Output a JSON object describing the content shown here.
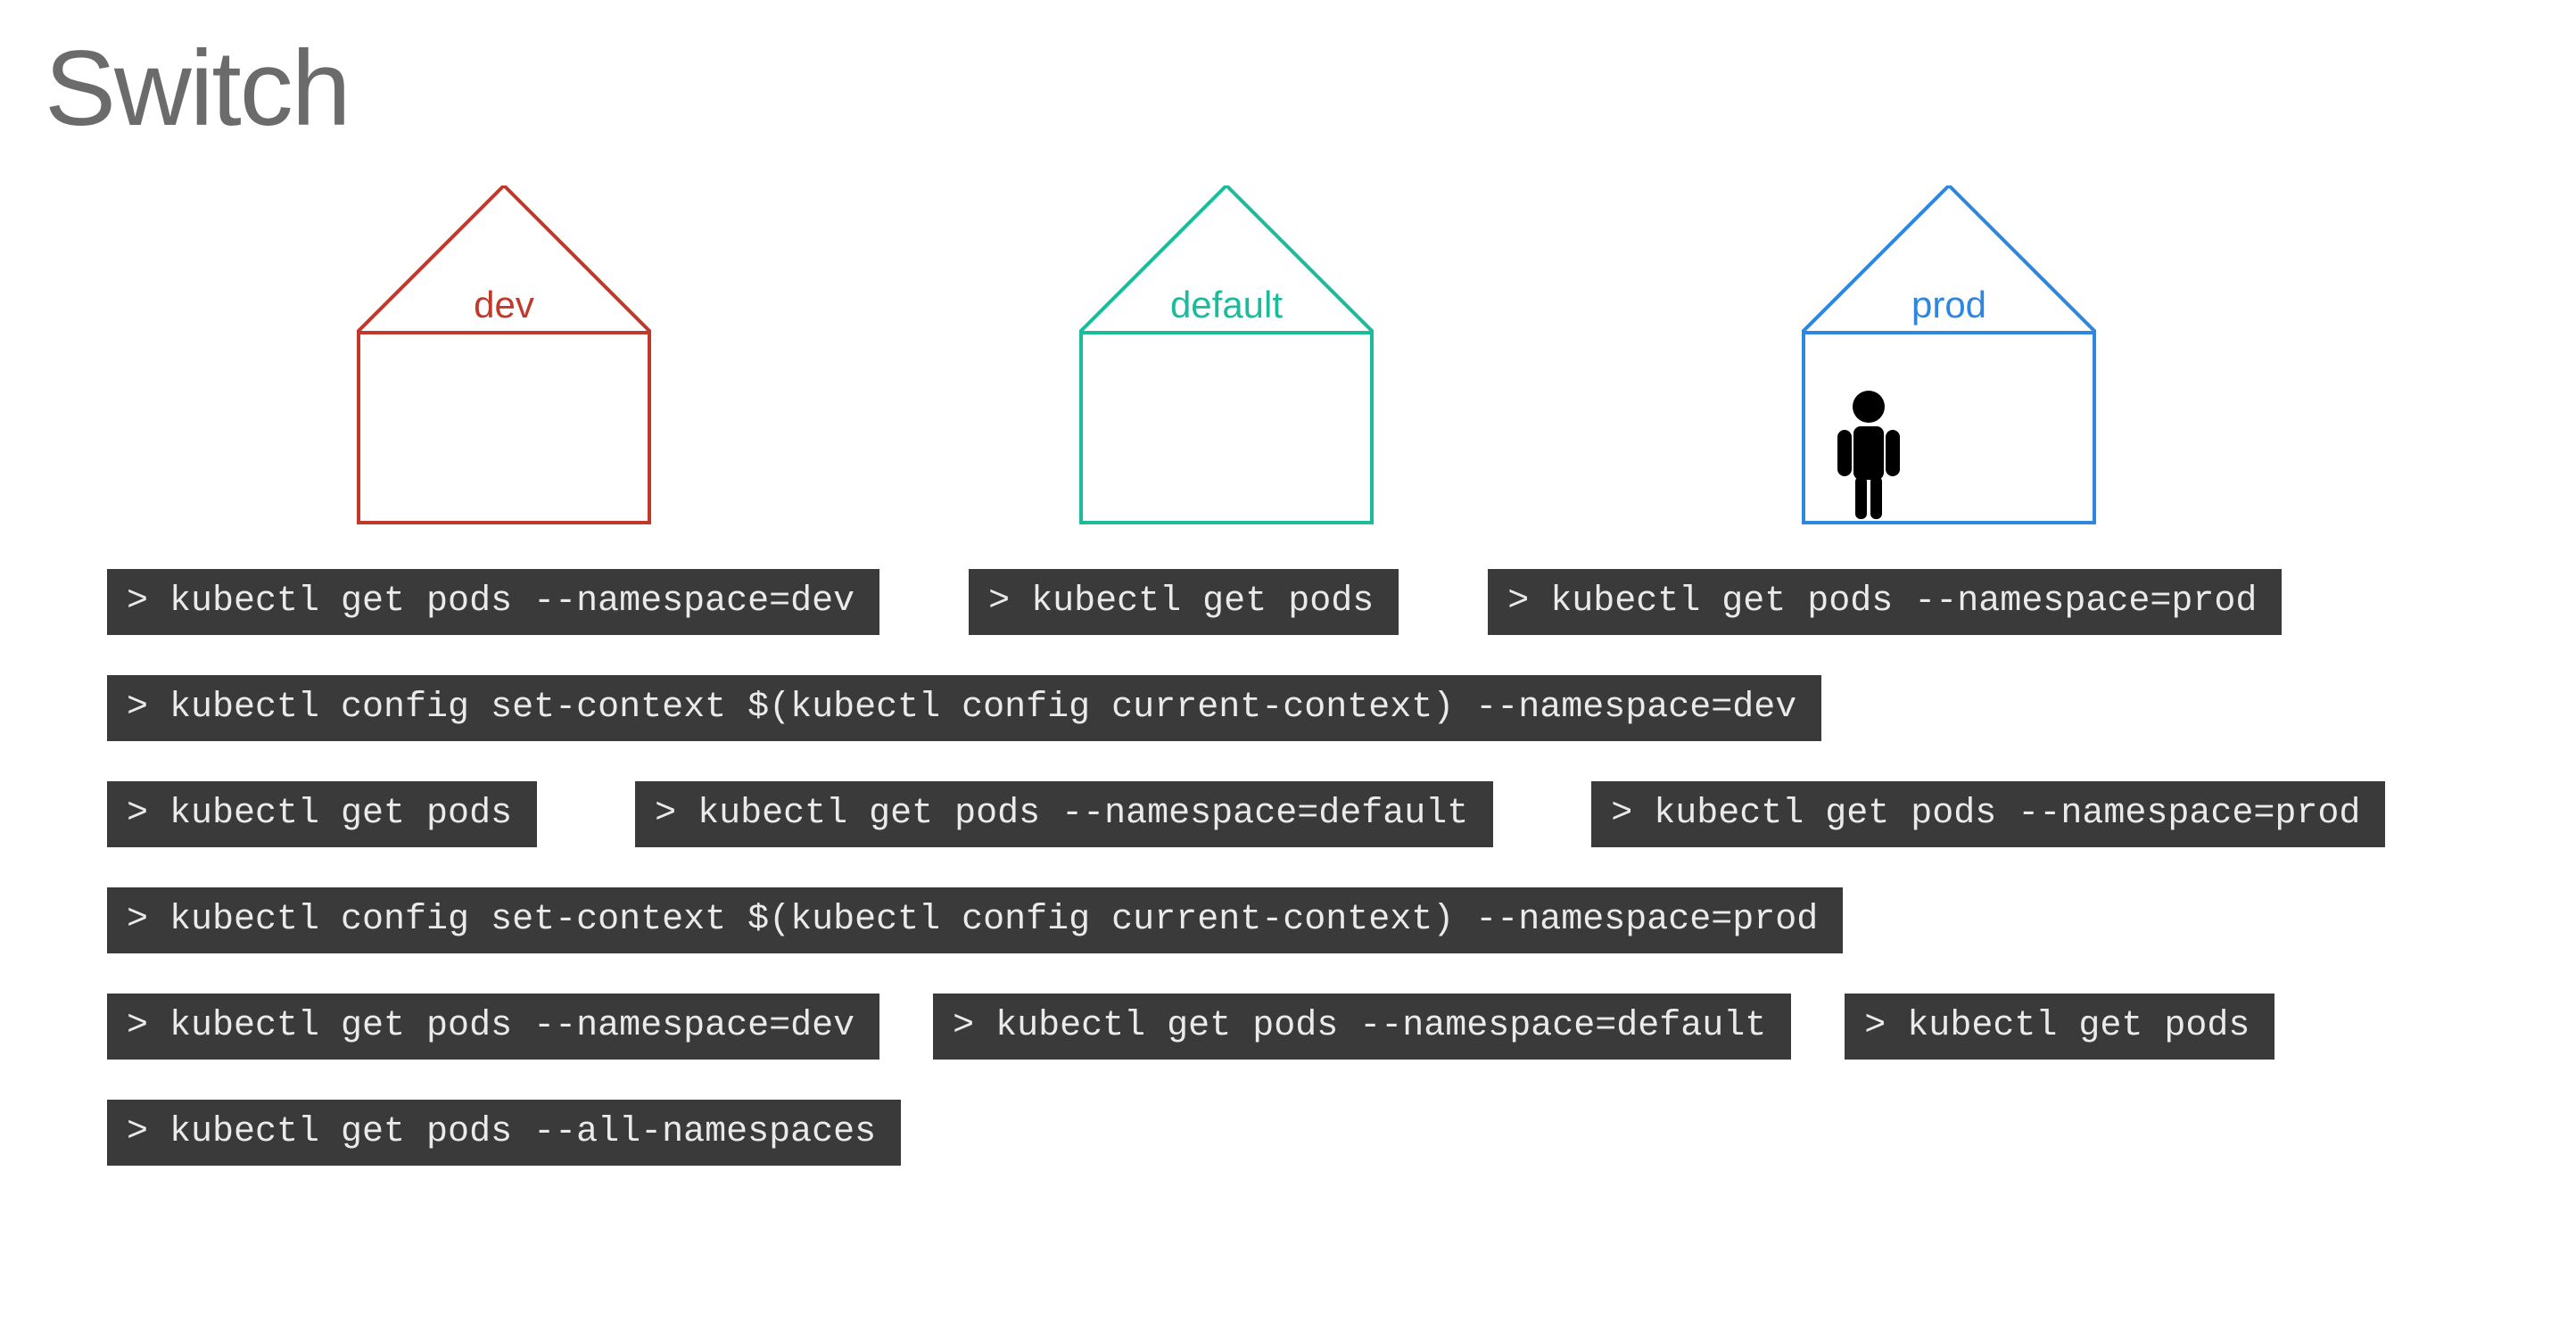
{
  "title": "Switch",
  "houses": [
    {
      "key": "dev",
      "label": "dev",
      "color": "#c0392b",
      "person": false
    },
    {
      "key": "def",
      "label": "default",
      "color": "#1abc9c",
      "person": false
    },
    {
      "key": "prod",
      "label": "prod",
      "color": "#2e86de",
      "person": true
    }
  ],
  "rows": [
    {
      "id": "row1",
      "cmds": [
        "> kubectl get pods --namespace=dev",
        "> kubectl get pods",
        "> kubectl get pods --namespace=prod"
      ]
    },
    {
      "id": "row2",
      "cmds": [
        "> kubectl config set-context $(kubectl config current-context) --namespace=dev"
      ]
    },
    {
      "id": "row3",
      "cmds": [
        "> kubectl get pods",
        "> kubectl get pods --namespace=default",
        "> kubectl get pods --namespace=prod"
      ]
    },
    {
      "id": "row4",
      "cmds": [
        "> kubectl config set-context $(kubectl config current-context) --namespace=prod"
      ]
    },
    {
      "id": "row5",
      "cmds": [
        "> kubectl get pods --namespace=dev",
        "> kubectl get pods --namespace=default",
        "> kubectl get pods"
      ]
    },
    {
      "id": "row6",
      "cmds": [
        "> kubectl get pods --all-namespaces"
      ]
    }
  ],
  "colors": {
    "cmd_bg": "#3a3a3a",
    "cmd_fg": "#eaeaea",
    "title": "#6b6b6b"
  }
}
